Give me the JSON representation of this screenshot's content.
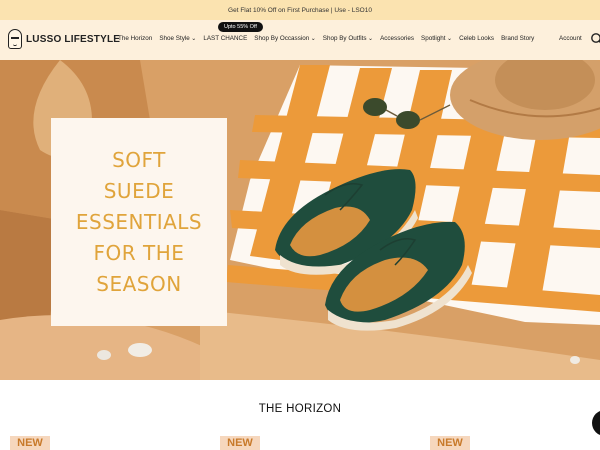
{
  "announcement": {
    "text": "Get Flat 10% Off on First Purchase | Use - LSO10"
  },
  "brand": {
    "name": "LUSSO LIFESTYLE"
  },
  "nav": {
    "items": [
      {
        "label": "The Horizon",
        "dropdown": false
      },
      {
        "label": "Shoe Style",
        "dropdown": true
      },
      {
        "label": "LAST CHANCE",
        "dropdown": false
      },
      {
        "label": "Shop By Occassion",
        "dropdown": true
      },
      {
        "label": "Shop By Outfits",
        "dropdown": true
      },
      {
        "label": "Accessories",
        "dropdown": false
      },
      {
        "label": "Spotlight",
        "dropdown": true
      },
      {
        "label": "Celeb Looks",
        "dropdown": false
      },
      {
        "label": "Brand Story",
        "dropdown": false
      }
    ],
    "badge": "Upto 55% Off",
    "account_label": "Account",
    "search_icon": "search-icon"
  },
  "hero": {
    "line1": "SOFT",
    "line2": "SUEDE",
    "line3": "ESSENTIALS",
    "line4": "FOR THE",
    "line5": "SEASON",
    "accent_color": "#e0a43b"
  },
  "section": {
    "title": "THE HORIZON"
  },
  "products": [
    {
      "badge": "NEW"
    },
    {
      "badge": "NEW"
    },
    {
      "badge": "NEW"
    }
  ]
}
